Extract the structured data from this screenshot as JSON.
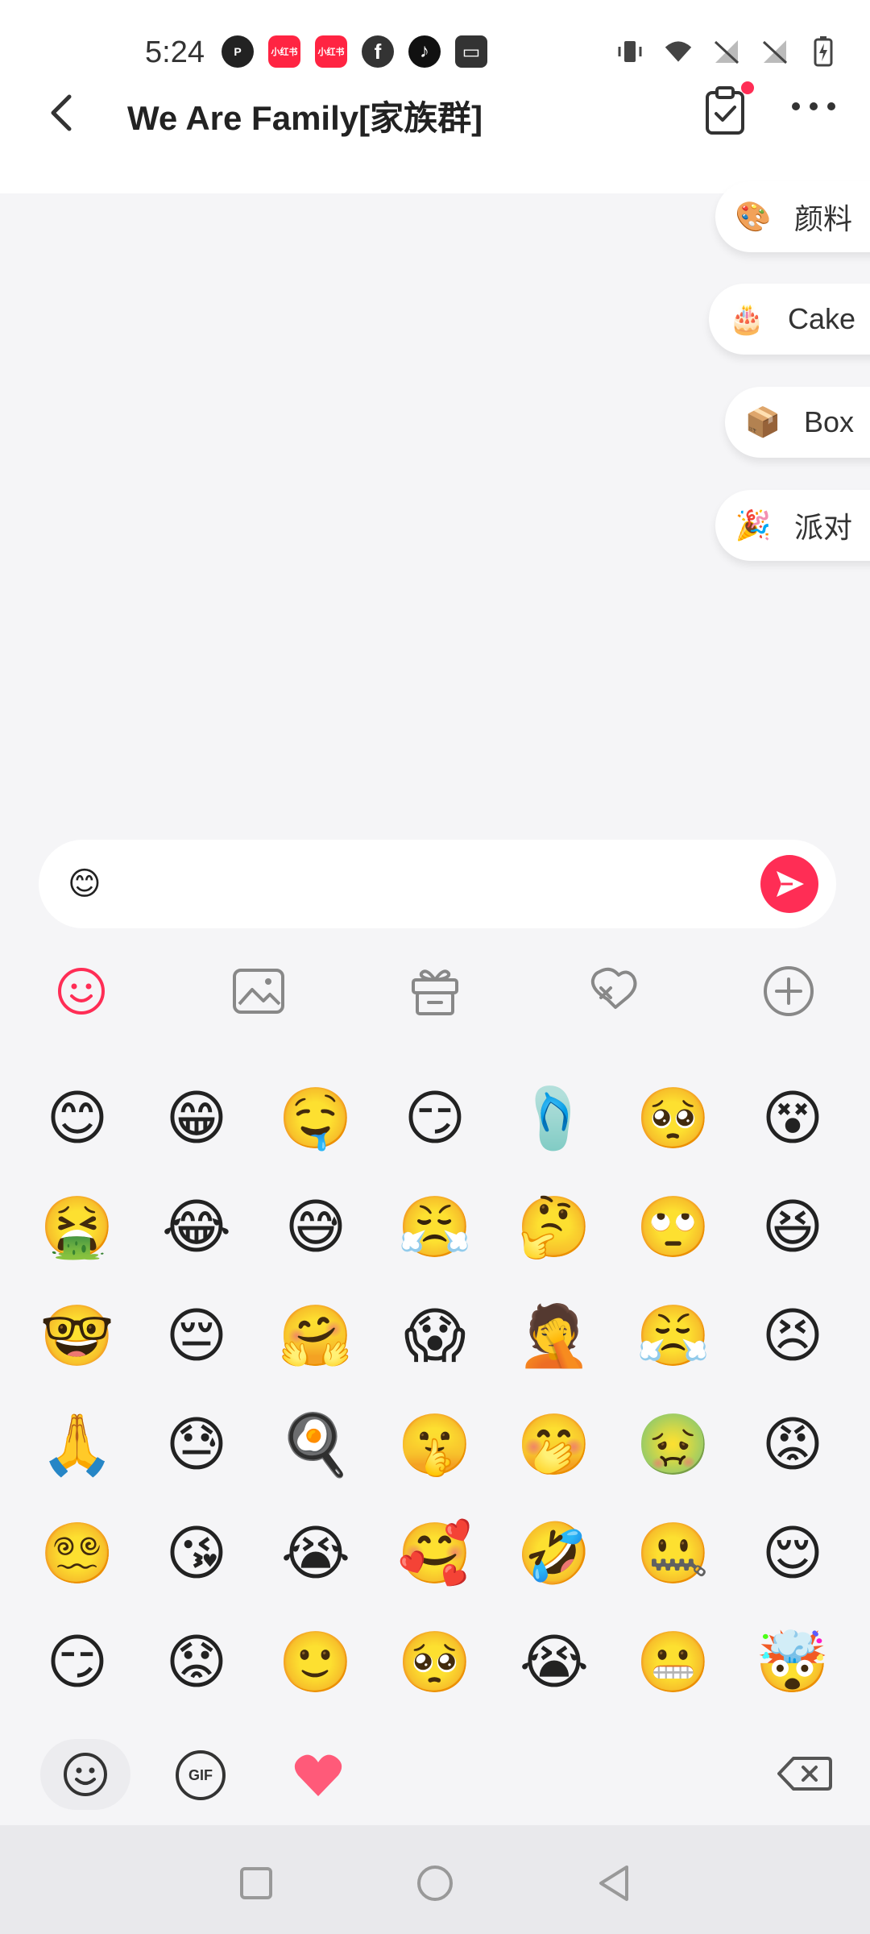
{
  "status_bar": {
    "time": "5:24",
    "app_icons": [
      {
        "name": "p-app-icon",
        "label": "P",
        "color": "#222222"
      },
      {
        "name": "xiaohongshu-icon",
        "label": "小红书",
        "color": "#ff2442"
      },
      {
        "name": "xiaohongshu-icon-2",
        "label": "小红书",
        "color": "#ff2442"
      },
      {
        "name": "facebook-icon",
        "label": "f",
        "color": "#333333"
      },
      {
        "name": "tiktok-icon",
        "label": "♪",
        "color": "#111111"
      },
      {
        "name": "wallet-icon",
        "label": "▭",
        "color": "#333333"
      }
    ]
  },
  "header": {
    "title": "We Are Family[家族群]",
    "back_icon": "chevron-left-icon",
    "task_icon": "clipboard-check-icon",
    "more_icon": "more-horizontal-icon",
    "accent": "#ff2d55"
  },
  "suggestions": [
    {
      "label": "颜料",
      "icon": "🎨"
    },
    {
      "label": "Cake",
      "icon": "🎂"
    },
    {
      "label": "Box",
      "icon": "📦"
    },
    {
      "label": "派对",
      "icon": "🎉"
    }
  ],
  "input": {
    "value": "😊",
    "send_icon": "send-icon"
  },
  "toolbar": [
    {
      "name": "emoji-tool",
      "icon": "smile-icon",
      "active": true
    },
    {
      "name": "image-tool",
      "icon": "image-icon",
      "active": false
    },
    {
      "name": "gift-tool",
      "icon": "gift-icon",
      "active": false
    },
    {
      "name": "voice-tool",
      "icon": "voice-icon",
      "active": false
    },
    {
      "name": "plus-tool",
      "icon": "plus-circle-icon",
      "active": false
    }
  ],
  "emoji_grid": [
    [
      "😊",
      "😁",
      "🤤",
      "😏",
      "🩴",
      "🥺",
      "😵"
    ],
    [
      "🤮",
      "😂",
      "😅",
      "😤",
      "🤔",
      "🙄",
      "😆"
    ],
    [
      "🤓",
      "😔",
      "🤗",
      "😱",
      "🤦",
      "😤",
      "😣"
    ],
    [
      "🙏",
      "😓",
      "🍳",
      "🤫",
      "🤭",
      "🤢",
      "😡"
    ],
    [
      "😵‍💫",
      "😘",
      "😭",
      "🥰",
      "🤣",
      "🤐",
      "😌"
    ],
    [
      "😏",
      "😟",
      "🙂",
      "🥺",
      "😭",
      "😬",
      "🤯"
    ]
  ],
  "bottom_bar": {
    "gif_label": "GIF"
  }
}
